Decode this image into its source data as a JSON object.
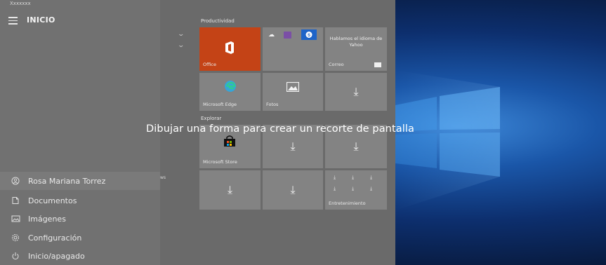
{
  "window": {
    "title_strip": "Xxxxxxx"
  },
  "header": {
    "menu_label": "INICIO"
  },
  "rail": {
    "items": [
      {
        "label": "Rosa Mariana Torrez",
        "icon": "user-icon"
      },
      {
        "label": "Documentos",
        "icon": "document-icon"
      },
      {
        "label": "Imágenes",
        "icon": "image-icon"
      },
      {
        "label": "Configuración",
        "icon": "gear-icon"
      },
      {
        "label": "Inicio/apagado",
        "icon": "power-icon"
      }
    ]
  },
  "groups": {
    "productividad": "Productividad",
    "explorar": "Explorar"
  },
  "tiles": {
    "office": "Office",
    "hablamos": "Hablamos el idioma de Yahoo",
    "correo": "Correo",
    "edge": "Microsoft Edge",
    "fotos": "Fotos",
    "store": "Microsoft Store",
    "entretenimiento": "Entretenimiento",
    "download_glyph": "⤓"
  },
  "misc": {
    "partial_ows": "ws"
  },
  "overlay": {
    "text": "Dibujar una forma para crear un recorte de pantalla"
  },
  "colors": {
    "office_tile": "#c44316",
    "accent_blue": "#1e64c8"
  }
}
